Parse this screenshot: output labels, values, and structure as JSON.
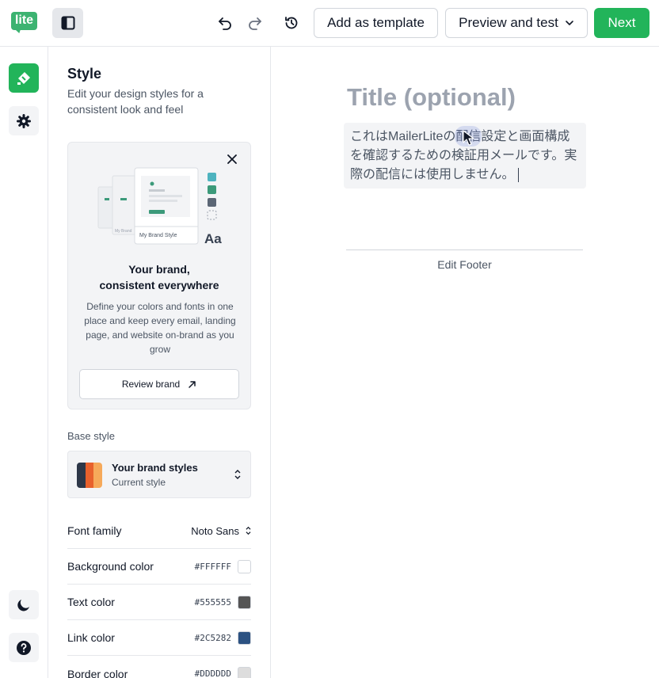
{
  "topbar": {
    "logo_text": "lite",
    "add_template_label": "Add as template",
    "preview_label": "Preview and test",
    "next_label": "Next"
  },
  "icons": {
    "sidebar_toggle": "sidebar-toggle-icon",
    "undo": "undo-icon",
    "redo": "redo-icon",
    "history": "history-icon",
    "style": "paint-brush-icon",
    "settings": "gear-icon",
    "dark_mode": "moon-icon",
    "help": "question-icon"
  },
  "panel": {
    "title": "Style",
    "subtitle": "Edit your design styles for a consistent look and feel",
    "brand_card": {
      "illustration_label": "My Brand Style",
      "illustration_label_small": "My Brand",
      "illustration_font": "Aa",
      "headline_1": "Your brand,",
      "headline_2": "consistent everywhere",
      "description": "Define your colors and fonts in one place and keep every email, landing page, and website on-brand as you grow",
      "review_label": "Review brand"
    },
    "base_style_label": "Base style",
    "base_select": {
      "title": "Your brand styles",
      "subtitle": "Current style"
    },
    "settings": [
      {
        "label": "Font family",
        "value": "Noto Sans"
      },
      {
        "label": "Background color",
        "value": "#FFFFFF",
        "color": "#FFFFFF"
      },
      {
        "label": "Text color",
        "value": "#555555",
        "color": "#555555"
      },
      {
        "label": "Link color",
        "value": "#2C5282",
        "color": "#2C5282"
      },
      {
        "label": "Border color",
        "value": "#DDDDDD",
        "color": "#DDDDDD"
      }
    ]
  },
  "canvas": {
    "title_placeholder": "Title (optional)",
    "body_text": "これはMailerLiteの配信設定と画面構成を確認するための検証用メールです。実際の配信には使用しません。",
    "footer_label": "Edit Footer"
  },
  "colors": {
    "accent": "#22B45A",
    "swatch": [
      "#2D3748",
      "#E8612C",
      "#F6A95A"
    ]
  }
}
